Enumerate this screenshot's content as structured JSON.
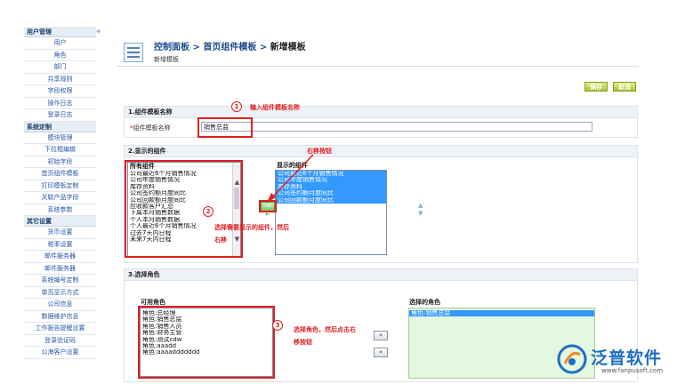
{
  "sidebar": {
    "sections": [
      {
        "title": "用户管理",
        "items": [
          "用户",
          "角色",
          "部门",
          "共享规则",
          "字段权限",
          "操作日志",
          "登录日志"
        ]
      },
      {
        "title": "系统定制",
        "items": [
          "模块管理",
          "下拉框编辑",
          "初始字段",
          "首页组件模板",
          "打印模板定制",
          "关联产品字段",
          "系统参数"
        ]
      },
      {
        "title": "其它设置",
        "items": [
          "货币设置",
          "税率设置",
          "邮件服务器",
          "邮件服务器",
          "系统编号定制",
          "单页显示方式",
          "公司信息",
          "数据维护信息",
          "工作报告提醒设置",
          "登录验证码",
          "公海客户设置"
        ]
      }
    ],
    "arrow_glyph": "◈"
  },
  "header": {
    "crumb1": "控制面板",
    "sep": " > ",
    "crumb2": "首页组件模板",
    "crumb3": "新增模板",
    "subtitle": "新增模板"
  },
  "buttons": {
    "save": "保存",
    "cancel": "取消"
  },
  "section1": {
    "title": "1.组件模板名称",
    "name_label": "组件模板名称",
    "required_mark": "*",
    "name_value": "销售总监"
  },
  "section2": {
    "title": "2.显示的组件",
    "all_title": "所有组件",
    "all_items": [
      "公司最近6个月销售情况",
      "公司年度销售情况",
      "库存资料",
      "公司签约额月度同比",
      "公司回款额月度同比",
      "应收款客户汇总",
      "下属本月销售数据",
      "个人本月销售数据",
      "个人最近6个月销售情况",
      "过去7天内日程",
      "未来7天内日程"
    ],
    "shown_title": "显示的组件",
    "shown_items": [
      "公司最近6个月销售情况",
      "公司年度销售情况",
      "库存资料",
      "公司签约额月度同比",
      "公司回款额月度同比"
    ],
    "move_right": "→",
    "move_left": "←"
  },
  "section3": {
    "title": "3.选择角色",
    "available_title": "可用角色",
    "available_items": [
      "角色:总经理",
      "角色:销售总监",
      "角色:销售人员",
      "角色:财务主管",
      "角色:测试cdw",
      "角色:aaadd",
      "角色:aaaaddddddd"
    ],
    "selected_title": "选择的角色",
    "selected_items": [
      "角色:销售总监"
    ],
    "add": "»",
    "remove": "«"
  },
  "annotations": {
    "n1": "1",
    "note1": "输入组件模板名称",
    "note_move": "右移按钮",
    "n2": "2",
    "note2a": "选择需要显示的组件，然后",
    "note2b": "右移",
    "n3": "3",
    "note3a": "选择角色，然后点击右",
    "note3b": "移按钮"
  },
  "logo": {
    "text": "泛普软件",
    "url": "www.fanpusoft.com"
  },
  "colors": {
    "accent": "#1e4c8c",
    "annotation": "#e02020",
    "selection": "#3399ff",
    "button": "#aec43a"
  }
}
